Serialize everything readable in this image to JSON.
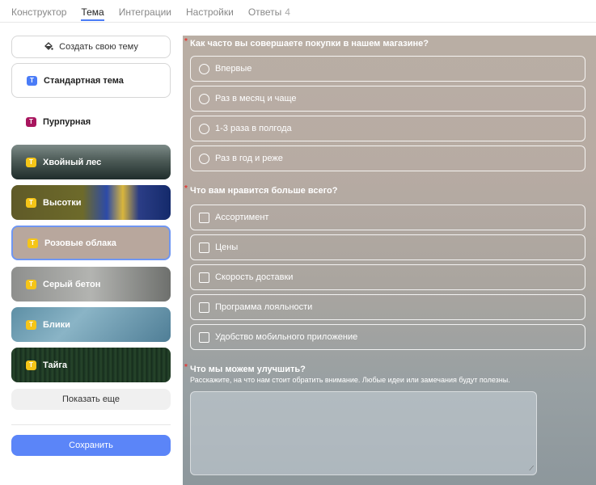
{
  "tabs": [
    {
      "label": "Конструктор"
    },
    {
      "label": "Тема",
      "active": true
    },
    {
      "label": "Интеграции"
    },
    {
      "label": "Настройки"
    },
    {
      "label": "Ответы",
      "count": "4"
    }
  ],
  "left": {
    "create_theme": "Создать свою тему",
    "themes": [
      {
        "name": "Стандартная тема",
        "badge": "T"
      },
      {
        "name": "Пурпурная",
        "badge": "T"
      },
      {
        "name": "Хвойный лес",
        "badge": "T"
      },
      {
        "name": "Высотки",
        "badge": "T"
      },
      {
        "name": "Розовые облака",
        "badge": "T",
        "selected": true
      },
      {
        "name": "Серый бетон",
        "badge": "T"
      },
      {
        "name": "Блики",
        "badge": "T"
      },
      {
        "name": "Тайга",
        "badge": "T"
      }
    ],
    "show_more": "Показать еще",
    "save": "Сохранить"
  },
  "form": {
    "q1": {
      "title": "Как часто вы совершаете покупки в нашем магазине?",
      "options": [
        "Впервые",
        "Раз в месяц и чаще",
        "1-3 раза в полгода",
        "Раз в год и реже"
      ]
    },
    "q2": {
      "title": "Что вам нравится больше всего?",
      "options": [
        "Ассортимент",
        "Цены",
        "Скорость доставки",
        "Программа лояльности",
        "Удобство мобильного приложение"
      ]
    },
    "q3": {
      "title": "Что мы можем улучшить?",
      "description": "Расскажите, на что нам стоит обратить внимание. Любые идеи или замечания будут полезны."
    },
    "required_mark": "*"
  },
  "colors": {
    "accent": "#5b85f8",
    "required": "#e53935",
    "badge_yellow": "#f5c518",
    "badge_purple": "#a8155e"
  }
}
